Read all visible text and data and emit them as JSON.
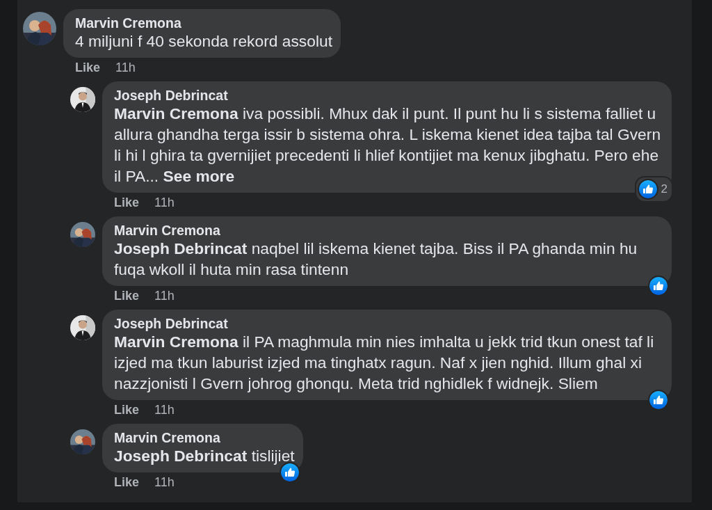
{
  "comments": [
    {
      "author": "Marvin Cremona",
      "text": "4 miljuni f 40 sekonda rekord assolut",
      "like": "Like",
      "time": "11h",
      "replies": [
        {
          "author": "Joseph Debrincat",
          "text": "**Marvin Cremona** iva possibli. Mhux dak il punt. Il punt hu li s sistema falliet u allura ghandha terga issir b sistema ohra. L iskema kienet idea tajba tal Gvern li hi l ghira ta gvernijiet precedenti li hlief kontijiet ma kenux jibghatu. Pero ehe il PA...",
          "see_more": "See more",
          "like": "Like",
          "time": "11h",
          "reaction_count": "2"
        },
        {
          "author": "Marvin Cremona",
          "text": "**Joseph Debrincat** naqbel lil iskema kienet tajba. Biss il PA ghanda min hu fuqa wkoll il huta min rasa tintenn",
          "like": "Like",
          "time": "11h",
          "reacted": true
        },
        {
          "author": "Joseph Debrincat",
          "text": "**Marvin Cremona** il PA maghmula min nies imhalta u jekk trid tkun onest taf li izjed ma tkun laburist izjed ma tinghatx ragun. Naf x jien nghid. Illum ghal xi nazzjonisti l Gvern johrog ghonqu. Meta trid nghidlek f widnejk. Sliem",
          "like": "Like",
          "time": "11h",
          "reacted": true
        },
        {
          "author": "Marvin Cremona",
          "text": "**Joseph Debrincat** tislijiet",
          "like": "Like",
          "time": "11h",
          "reacted": true
        }
      ]
    }
  ]
}
